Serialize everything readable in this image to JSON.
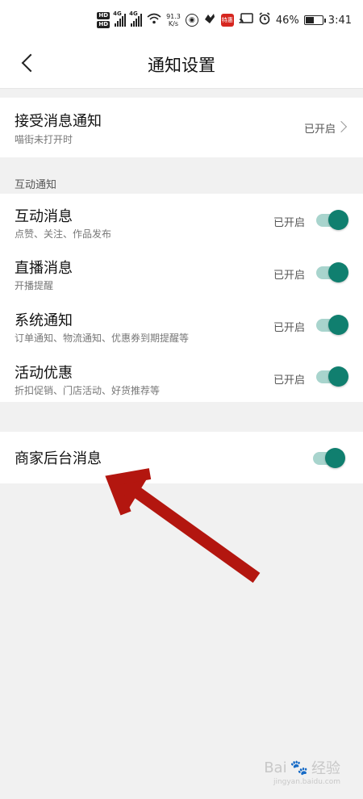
{
  "status_bar": {
    "hd_top": "HD",
    "hd_bottom": "HD",
    "net1": "4G",
    "net2": "4G",
    "speed_value": "91.3",
    "speed_unit": "K/s",
    "red_app_label": "特惠",
    "battery": "46%",
    "time": "3:41"
  },
  "nav": {
    "title": "通知设置"
  },
  "receive": {
    "title": "接受消息通知",
    "subtitle": "喵街未打开时",
    "state": "已开启"
  },
  "section": {
    "label": "互动通知"
  },
  "items": [
    {
      "title": "互动消息",
      "subtitle": "点赞、关注、作品发布",
      "state": "已开启",
      "enabled": true
    },
    {
      "title": "直播消息",
      "subtitle": "开播提醒",
      "state": "已开启",
      "enabled": true
    },
    {
      "title": "系统通知",
      "subtitle": "订单通知、物流通知、优惠券到期提醒等",
      "state": "已开启",
      "enabled": true
    },
    {
      "title": "活动优惠",
      "subtitle": "折扣促销、门店活动、好货推荐等",
      "state": "已开启",
      "enabled": true
    }
  ],
  "merchant": {
    "title": "商家后台消息",
    "enabled": true
  },
  "watermark": {
    "brand": "Bai",
    "brand2": "经验",
    "domain": "jingyan.baidu.com"
  },
  "colors": {
    "toggle_on": "#107f6f",
    "toggle_track": "#a8d4cd",
    "annotation_arrow": "#b3160f"
  }
}
